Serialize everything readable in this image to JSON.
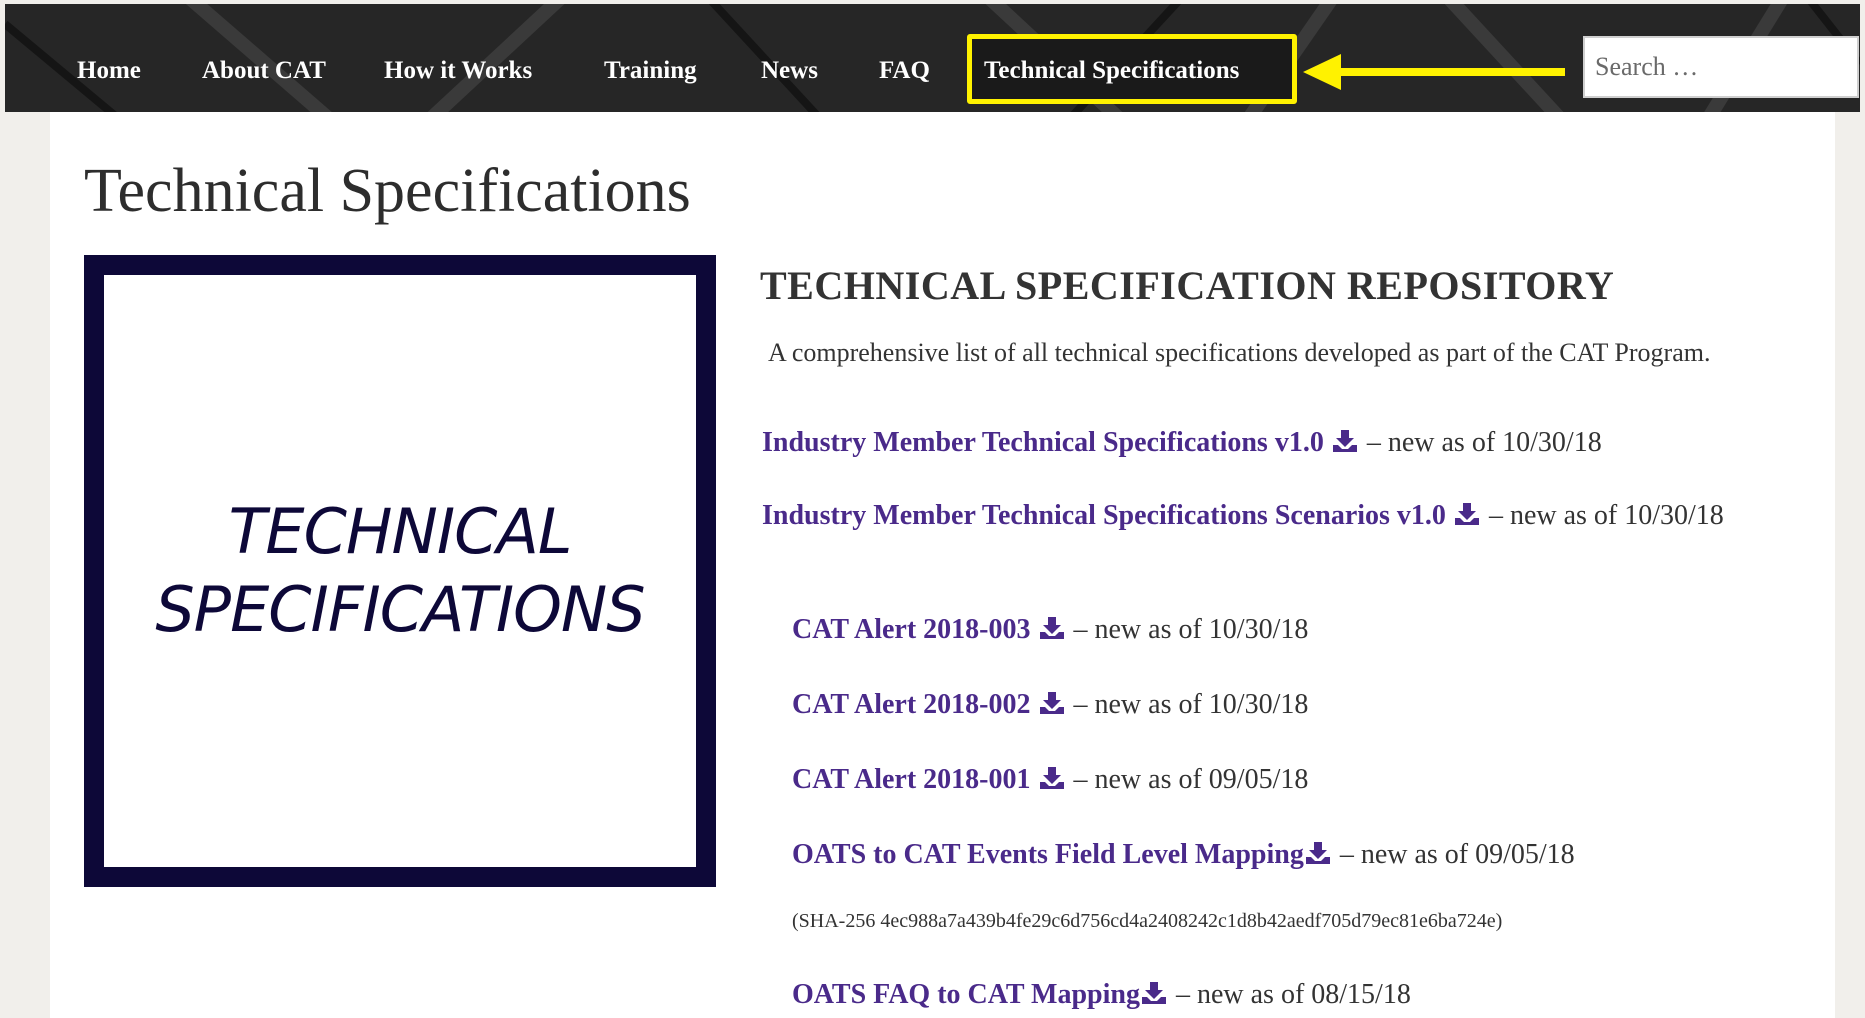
{
  "nav": {
    "items": [
      {
        "label": "Home"
      },
      {
        "label": "About CAT"
      },
      {
        "label": "How it Works"
      },
      {
        "label": "Training"
      },
      {
        "label": "News"
      },
      {
        "label": "FAQ"
      },
      {
        "label": "Technical Specifications"
      }
    ],
    "search_placeholder": "Search …",
    "highlight_color": "#fff200"
  },
  "page": {
    "title": "Technical Specifications"
  },
  "logo": {
    "line1": "TECHNICAL",
    "line2": "SPECIFICATIONS",
    "color": "#0d0838"
  },
  "repository": {
    "heading": "TECHNICAL SPECIFICATION REPOSITORY",
    "description": "A comprehensive list of all technical specifications developed as part of the CAT Program.",
    "documents": [
      {
        "title": "Industry Member Technical Specifications v1.0",
        "note": "– new as of 10/30/18"
      },
      {
        "title": "Industry Member Technical Specifications Scenarios v1.0",
        "note": "– new as of 10/30/18"
      },
      {
        "title": "CAT Alert 2018-003",
        "note": "– new as of 10/30/18"
      },
      {
        "title": "CAT Alert 2018-002",
        "note": "– new as of 10/30/18"
      },
      {
        "title": "CAT Alert 2018-001",
        "note": "– new as of 09/05/18"
      },
      {
        "title": "OATS to CAT Events Field Level Mapping",
        "note": "– new as of 09/05/18"
      },
      {
        "title": "OATS FAQ to CAT Mapping",
        "note": "– new as of 08/15/18"
      }
    ],
    "sha_note": "(SHA-256 4ec988a7a439b4fe29c6d756cd4a2408242c1d8b42aedf705d79ec81e6ba724e)",
    "link_color": "#4a2a8a",
    "icon": "download-icon"
  }
}
